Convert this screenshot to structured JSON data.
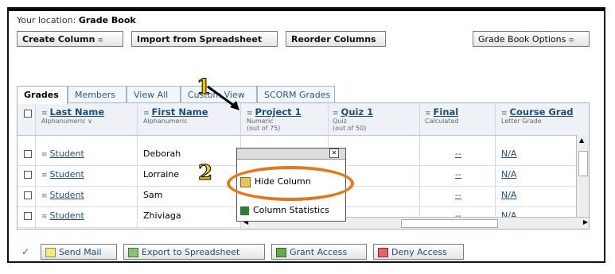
{
  "location": {
    "prefix": "Your location:",
    "current": "Grade Book"
  },
  "toolbar": {
    "create_column": "Create Column",
    "import": "Import from Spreadsheet",
    "reorder": "Reorder Columns",
    "options": "Grade Book Options"
  },
  "tabs": [
    "Grades",
    "Members",
    "View All",
    "Custom View",
    "SCORM Grades"
  ],
  "columns": {
    "last_name": {
      "title": "Last Name",
      "sub": "Alphanumeric"
    },
    "first_name": {
      "title": "First Name",
      "sub": "Alphanumeric"
    },
    "project": {
      "title": "Project 1",
      "sub1": "Numeric",
      "sub2": "(out of 75)"
    },
    "quiz": {
      "title": "Quiz 1",
      "sub1": "Quiz",
      "sub2": "(out of 50)"
    },
    "final": {
      "title": "Final",
      "sub": "Calculated"
    },
    "course": {
      "title": "Course Grad",
      "sub": "Letter Grade"
    }
  },
  "rows": [
    {
      "last": "Student",
      "first": "Deborah",
      "final": "--",
      "course": "N/A"
    },
    {
      "last": "Student",
      "first": "Lorraine",
      "final": "--",
      "course": "N/A"
    },
    {
      "last": "Student",
      "first": "Sam",
      "final": "--",
      "course": "N/A"
    },
    {
      "last": "Student",
      "first": "Zhiviaga",
      "final": "--",
      "course": "N/A"
    }
  ],
  "popup": {
    "hide": "Hide Column",
    "stats": "Column Statistics"
  },
  "callouts": {
    "one": "1",
    "two": "2"
  },
  "bottom": {
    "send_mail": "Send Mail",
    "export": "Export to Spreadsheet",
    "grant": "Grant Access",
    "deny": "Deny Access"
  },
  "colors": {
    "accent": "#e8751a",
    "link": "#1f4d7a",
    "callout": "#f1c400"
  }
}
